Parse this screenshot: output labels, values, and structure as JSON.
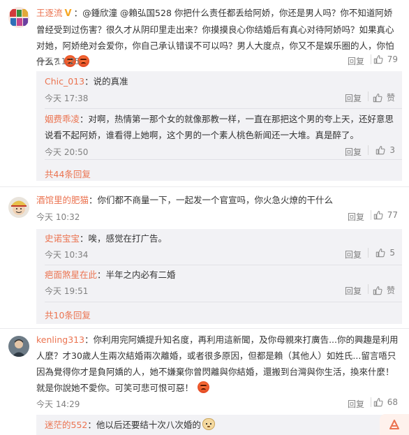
{
  "comments": [
    {
      "user": "王逐流",
      "verified": "V",
      "text": "：@鍾欣潼 @賴弘国528 你把什么责任都丢给阿娇，你还是男人吗？你不知道阿娇曾经受到过伤害？很久才从阴印里走出来？你摸摸良心你结婚后有真心对待阿娇吗？如果真心对她，阿娇绝对会爱你，你自己承认错误不可以吗？男人大度点，你又不是娱乐圈的人，你怕什么？",
      "time": "今天 11:25",
      "reply": "回复",
      "likes": "79",
      "replies": [
        {
          "user": "Chic_013",
          "text": "：说的真准",
          "time": "今天 17:38",
          "reply": "回复",
          "likes": "赞"
        },
        {
          "user": "姻费乖凌",
          "text": "：对啊，热情第一那个女的就像那教一样，一直在那把这个男的夸上天，还好意思说看不起阿娇，谁看得上她啊，这个男的一个素人桃色新闻还一大堆。真是醉了。",
          "time": "今天 20:50",
          "reply": "回复",
          "likes": "3"
        }
      ],
      "more": "共44条回复"
    },
    {
      "user": "酒馆里的肥猫",
      "text": "：你们都不商量一下，一起发一个官宣吗，你火急火燎的干什么",
      "time": "今天 10:32",
      "reply": "回复",
      "likes": "77",
      "replies": [
        {
          "user": "史诺宝宝",
          "text": "：唉，感觉在打广告。",
          "time": "今天 10:34",
          "reply": "回复",
          "likes": "5"
        },
        {
          "user": "疤面煞星在此",
          "text": "：半年之内必有二婚",
          "time": "今天 19:51",
          "reply": "回复",
          "likes": "赞"
        }
      ],
      "more": "共10条回复"
    },
    {
      "user": "kenling313",
      "text": "：你利用完阿嬌提升知名度，再利用這新聞，及你母親來打廣告...你的興趣是利用人麼？才30歲人生兩次結婚兩次離婚，或者很多原因，但都是賴（其他人）如姓氏...留言唔只因為覺得你才是負阿嬌的人，她不嫌棄你曾閃離與你結婚，還搬到台灣與你生活，換來什麼！就是你說她不愛你。可笑可悲可恨可惡！",
      "time": "今天 14:29",
      "reply": "回复",
      "likes": "68",
      "replies": [
        {
          "user": "迷茫的552",
          "text": "：他以后还要结十次八次婚的",
          "time": "",
          "reply": "",
          "likes": ""
        }
      ]
    }
  ],
  "icons": {
    "like": "thumbs-up-icon",
    "angry": "angry-face-emoji",
    "dog": "dog-face-emoji",
    "share": "share-icon"
  },
  "colors": {
    "username": "#eb7350",
    "meta": "#808080",
    "reply_bg": "#f2f2f5",
    "verified": "#f5a623"
  }
}
